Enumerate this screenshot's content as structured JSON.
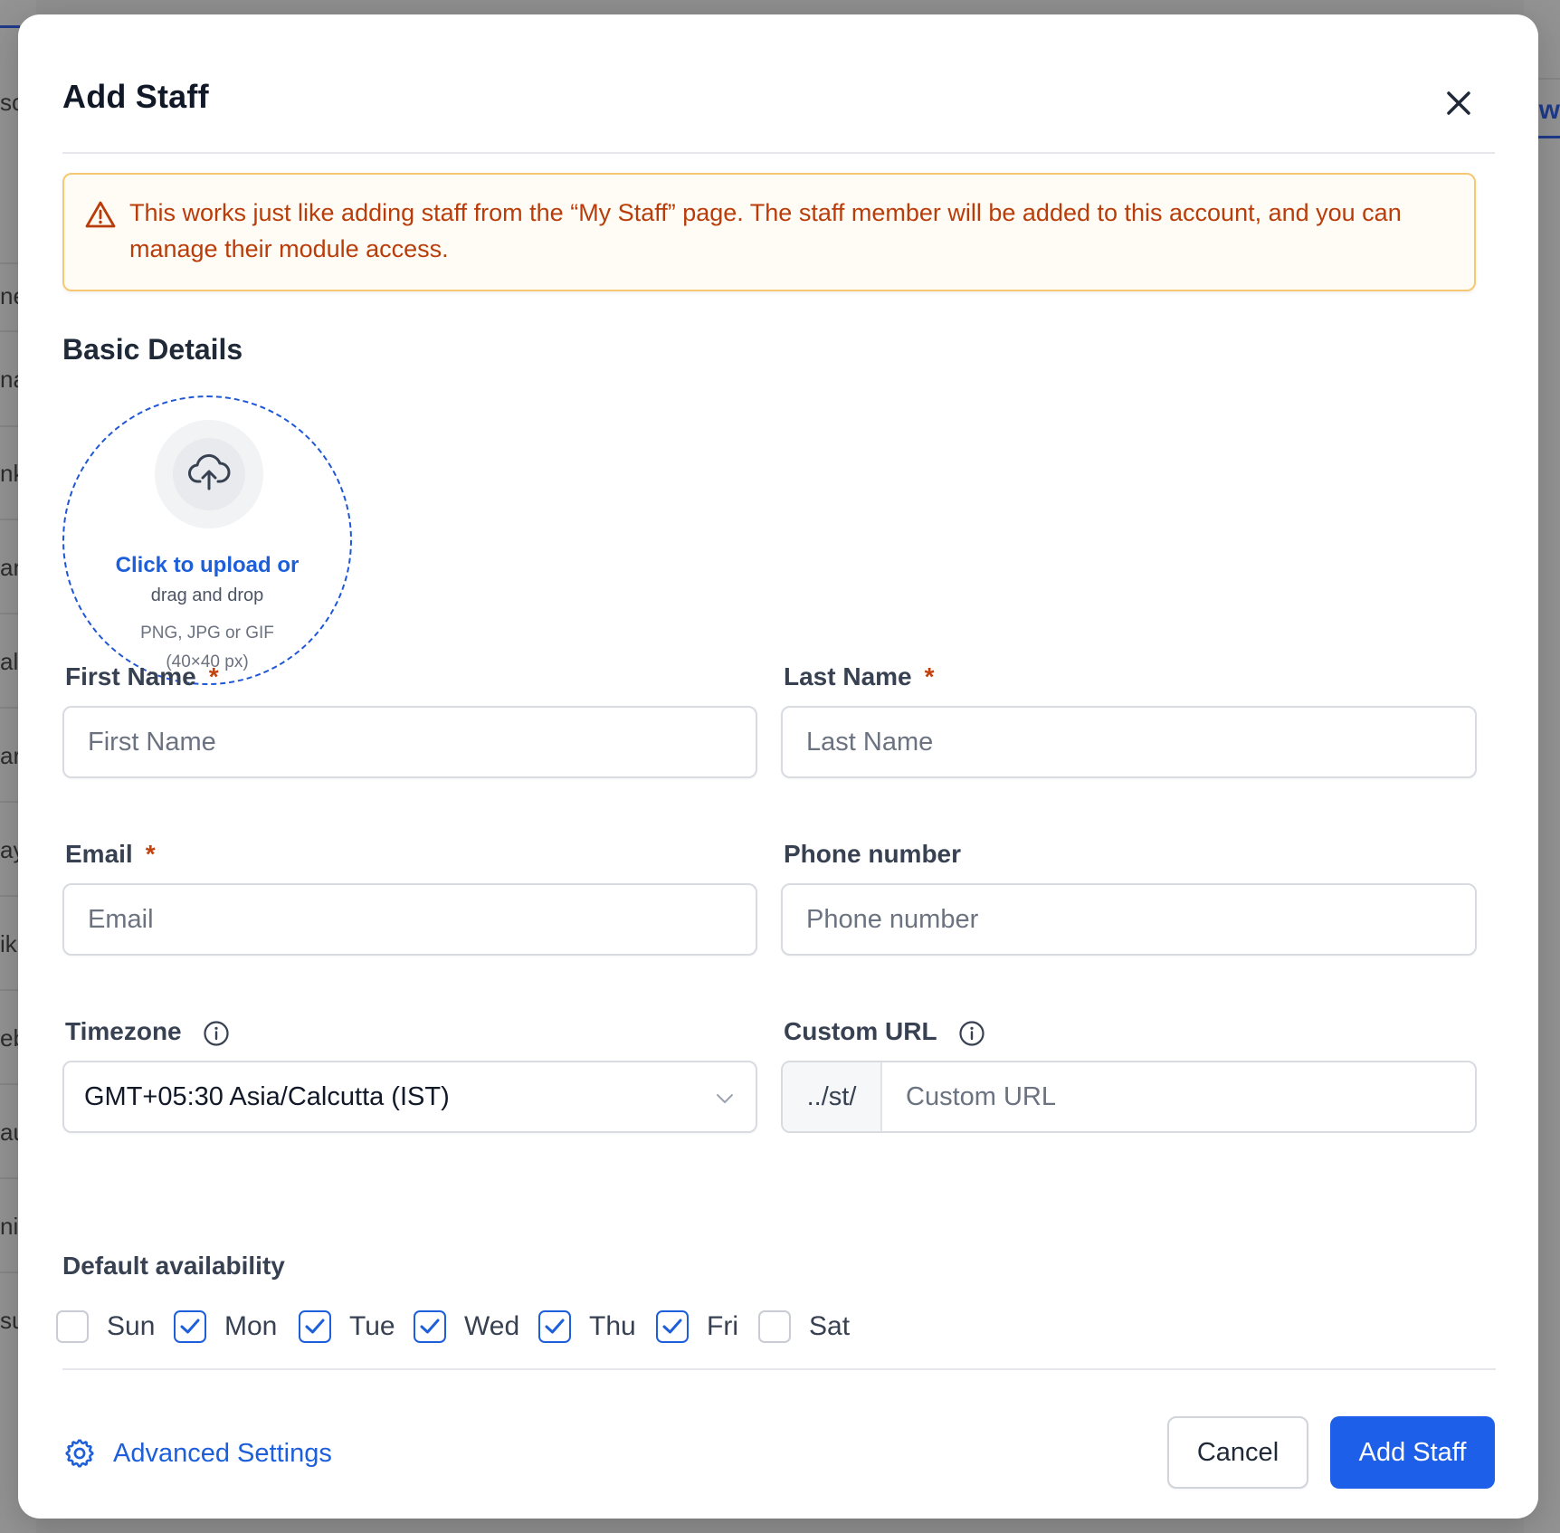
{
  "background": {
    "left_fragments": [
      "sc",
      "ne",
      "na",
      "nk",
      "an",
      "alo",
      "ar",
      "ay",
      "ik",
      "eb",
      "au",
      "ni",
      "su"
    ],
    "right_fragment": "ew"
  },
  "modal": {
    "title": "Add Staff",
    "close_icon": "close-icon",
    "alert": {
      "icon": "warning-triangle-icon",
      "text": "This works just like adding staff from the “My Staff” page. The staff member will be added to this account, and you can manage their module access."
    },
    "section_title": "Basic Details",
    "upload": {
      "icon": "cloud-upload-icon",
      "line1": "Click to upload or",
      "line2": "drag and drop",
      "line3": "PNG, JPG or GIF",
      "line4": "(40×40 px)"
    },
    "fields": {
      "first_name": {
        "label": "First Name",
        "required": "*",
        "placeholder": "First Name"
      },
      "last_name": {
        "label": "Last Name",
        "required": "*",
        "placeholder": "Last Name"
      },
      "email": {
        "label": "Email",
        "required": "*",
        "placeholder": "Email"
      },
      "phone": {
        "label": "Phone number",
        "placeholder": "Phone number"
      },
      "timezone": {
        "label": "Timezone",
        "value": "GMT+05:30 Asia/Calcutta (IST)"
      },
      "custom_url": {
        "label": "Custom URL",
        "prefix": "../st/",
        "placeholder": "Custom URL"
      }
    },
    "availability": {
      "title": "Default availability",
      "days": [
        {
          "label": "Sun",
          "checked": false
        },
        {
          "label": "Mon",
          "checked": true
        },
        {
          "label": "Tue",
          "checked": true
        },
        {
          "label": "Wed",
          "checked": true
        },
        {
          "label": "Thu",
          "checked": true
        },
        {
          "label": "Fri",
          "checked": true
        },
        {
          "label": "Sat",
          "checked": false
        }
      ]
    },
    "footer": {
      "advanced_settings": "Advanced Settings",
      "advanced_icon": "gear-icon",
      "cancel": "Cancel",
      "submit": "Add Staff"
    }
  },
  "colors": {
    "primary": "#1d5fe8",
    "link": "#1d5fdb",
    "alert_text": "#b93d0a",
    "alert_border": "#f7c873",
    "required": "#c2410c"
  }
}
